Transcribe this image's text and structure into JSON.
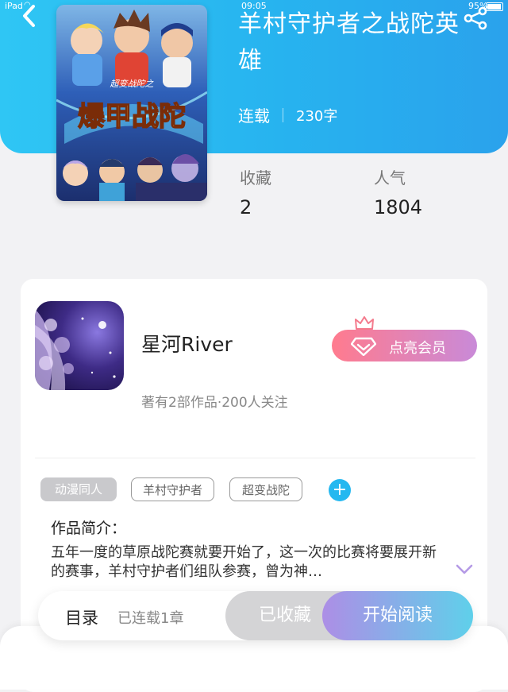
{
  "status_bar": {
    "device": "iPad",
    "time": "09:05",
    "battery": "95%"
  },
  "book": {
    "title": "羊村守护者之战陀英雄",
    "status": "连载",
    "word_count": "230字",
    "cover_title": "爆甲战陀",
    "cover_subtitle": "超变战陀之"
  },
  "stats": [
    {
      "label": "收藏",
      "value": "2"
    },
    {
      "label": "人气",
      "value": "1804"
    }
  ],
  "author": {
    "name": "星河River",
    "info": "著有2部作品·200人关注",
    "vip_button": "点亮会员"
  },
  "tags": {
    "genre": "动漫同人",
    "keywords": [
      "羊村守护者",
      "超变战陀"
    ],
    "add_symbol": "+"
  },
  "synopsis": {
    "label": "作品简介：",
    "text": "五年一度的草原战陀赛就要开始了，这一次的比赛将要展开新的赛事，羊村守护者们组队参赛，曾为神…"
  },
  "bottom_bar": {
    "toc_label": "目录",
    "toc_status": "已连载1章",
    "favorite_button": "已收藏",
    "read_button": "开始阅读"
  },
  "colors": {
    "header_blue": "#2fb6ef",
    "vip_pink": "#ff7b8e",
    "tag_add_blue": "#24b8f0",
    "read_gradient_end": "#5fd0ea"
  }
}
